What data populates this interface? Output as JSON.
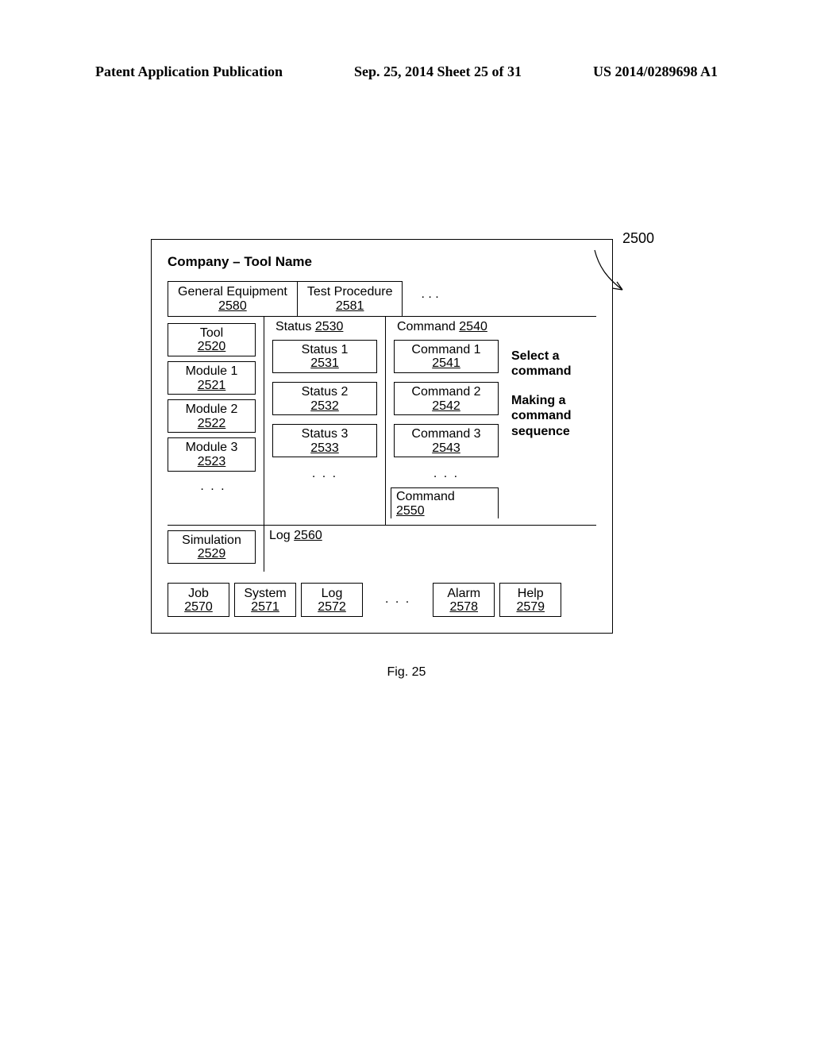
{
  "header": {
    "left": "Patent Application Publication",
    "center": "Sep. 25, 2014  Sheet 25 of 31",
    "right": "US 2014/0289698 A1"
  },
  "figure_ref": "2500",
  "panel": {
    "title": "Company – Tool Name",
    "tabs": [
      {
        "label": "General Equipment",
        "ref": "2580"
      },
      {
        "label": "Test Procedure",
        "ref": "2581"
      }
    ],
    "tabs_more": ". . .",
    "left_items": [
      {
        "label": "Tool",
        "ref": "2520"
      },
      {
        "label": "Module 1",
        "ref": "2521"
      },
      {
        "label": "Module 2",
        "ref": "2522"
      },
      {
        "label": "Module 3",
        "ref": "2523"
      }
    ],
    "left_more": ". . .",
    "status_header": {
      "label": "Status",
      "ref": "2530"
    },
    "status_items": [
      {
        "label": "Status 1",
        "ref": "2531"
      },
      {
        "label": "Status 2",
        "ref": "2532"
      },
      {
        "label": "Status 3",
        "ref": "2533"
      }
    ],
    "status_more": ". . .",
    "command_header": {
      "label": "Command",
      "ref": "2540"
    },
    "command_items": [
      {
        "label": "Command 1",
        "ref": "2541"
      },
      {
        "label": "Command 2",
        "ref": "2542"
      },
      {
        "label": "Command 3",
        "ref": "2543"
      }
    ],
    "command_more": ". . .",
    "command_last": {
      "label": "Command",
      "ref": "2550"
    },
    "right_hints": {
      "line1": "Select a command",
      "line2": "Making a command sequence"
    },
    "simulation": {
      "label": "Simulation",
      "ref": "2529"
    },
    "log_header": {
      "label": "Log",
      "ref": "2560"
    },
    "bottom_buttons": [
      {
        "label": "Job",
        "ref": "2570"
      },
      {
        "label": "System",
        "ref": "2571"
      },
      {
        "label": "Log",
        "ref": "2572"
      }
    ],
    "bottom_more": ". . .",
    "bottom_buttons_right": [
      {
        "label": "Alarm",
        "ref": "2578"
      },
      {
        "label": "Help",
        "ref": "2579"
      }
    ]
  },
  "fig_caption": "Fig. 25"
}
